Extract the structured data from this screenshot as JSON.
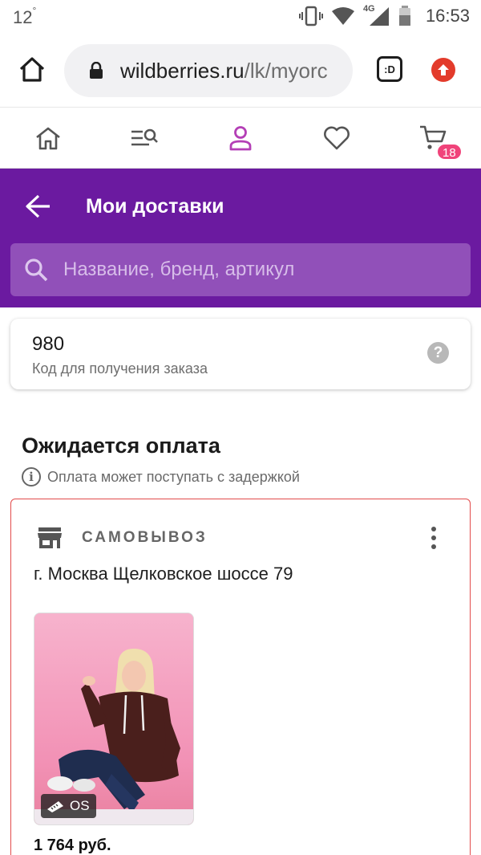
{
  "status_bar": {
    "temperature": "12",
    "degree": "°",
    "network": "4G",
    "time": "16:53"
  },
  "browser": {
    "url_domain": "wildberries.ru",
    "url_path": "/lk/myorc",
    "tabs_label": ":D"
  },
  "nav": {
    "cart_count": "18",
    "active_color": "#b43fb6"
  },
  "header": {
    "title": "Мои доставки",
    "search_placeholder": "Название, бренд, артикул"
  },
  "pickup_code": {
    "value": "980",
    "label": "Код для получения заказа",
    "help": "?"
  },
  "section": {
    "title": "Ожидается оплата",
    "notice": "Оплата может поступать с задержкой"
  },
  "delivery": {
    "type": "САМОВЫВОЗ",
    "address": "г. Москва Щелковское шоссе 79",
    "product": {
      "size": "OS",
      "price": "1 764 руб."
    }
  },
  "colors": {
    "brand_purple": "#6b1aa0",
    "badge_pink": "#f0437a",
    "alert_border": "#e24b4b"
  }
}
